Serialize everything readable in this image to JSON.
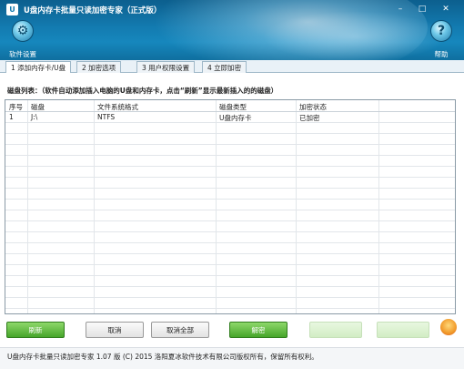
{
  "window": {
    "title": "U盘内存卡批量只读加密专家（正式版）",
    "controls": [
      "–",
      "□",
      "✕"
    ]
  },
  "toolbar": {
    "settings_label": "软件设置",
    "help_label": "帮助"
  },
  "tabs": [
    {
      "label": "1 添加内存卡/U盘",
      "active": true
    },
    {
      "label": "2 加密选项",
      "active": false
    },
    {
      "label": "3 用户权限设置",
      "active": false
    },
    {
      "label": "4 立即加密",
      "active": false
    }
  ],
  "disk_list": {
    "label": "磁盘列表：（软件自动添加插入电脑的U盘和内存卡，点击“刷新”显示最新插入的的磁盘）",
    "columns": [
      "序号",
      "磁盘",
      "文件系统格式",
      "磁盘类型",
      "加密状态"
    ],
    "rows": [
      [
        "1",
        "J:\\",
        "NTFS",
        "U盘内存卡",
        "已加密"
      ]
    ]
  },
  "buttons": {
    "refresh": "刷新",
    "cancel": "取消",
    "cancel_all": "取消全部",
    "decrypt": "解密",
    "faded_1": "",
    "faded_2": ""
  },
  "status_bar": {
    "text": "U盘内存卡批量只读加密专家 1.07 版 (C) 2015 洛阳夏冰软件技术有限公司版权所有，保留所有权利。"
  },
  "colors": {
    "header": "#137bb0",
    "accent_green": "#46a52a"
  },
  "icons": {
    "settings": "gear-icon",
    "help": "question-icon",
    "logo": "app-logo-icon"
  }
}
